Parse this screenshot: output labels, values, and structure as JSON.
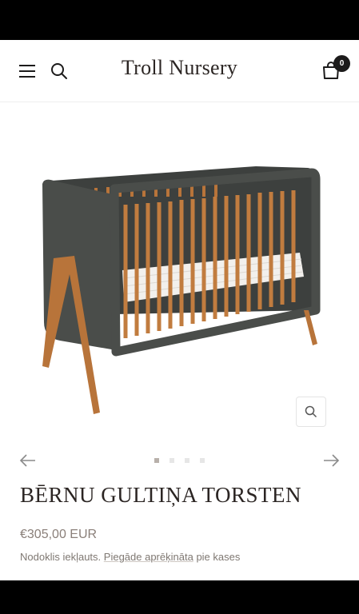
{
  "header": {
    "logo_text": "Troll Nursery",
    "cart_count": "0",
    "icons": [
      "menu-icon",
      "search-icon",
      "cart-icon"
    ]
  },
  "gallery": {
    "image_alt": "crib-image",
    "slide_count": 4,
    "active_slide": 1,
    "icons": [
      "zoom-icon",
      "arrow-left-icon",
      "arrow-right-icon"
    ]
  },
  "product": {
    "title": "BĒRNU GULTIŅA TORSTEN",
    "price": "€305,00 EUR",
    "tax_note_prefix": "Nodoklis iekļauts.",
    "shipping_link": "Piegāde aprēķināta",
    "tax_note_suffix": "pie kases"
  },
  "colors": {
    "crib_frame": "#4a4d4a",
    "crib_wood": "#b8743a",
    "text_dark": "#1c1b1b",
    "price_text": "#8a7f79"
  }
}
